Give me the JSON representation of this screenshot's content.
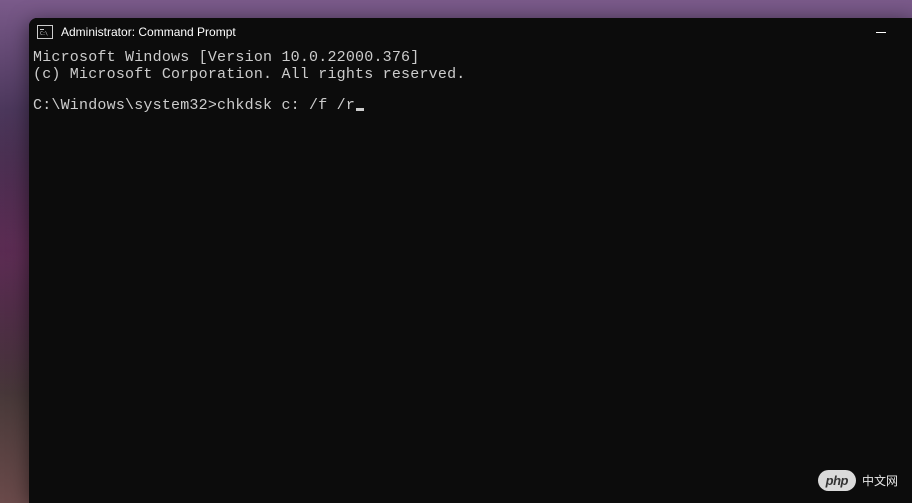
{
  "titlebar": {
    "title": "Administrator: Command Prompt"
  },
  "terminal": {
    "line1": "Microsoft Windows [Version 10.0.22000.376]",
    "line2": "(c) Microsoft Corporation. All rights reserved.",
    "prompt": "C:\\Windows\\system32>",
    "command": "chkdsk c: /f /r"
  },
  "watermark": {
    "logo": "php",
    "text": "中文网"
  }
}
